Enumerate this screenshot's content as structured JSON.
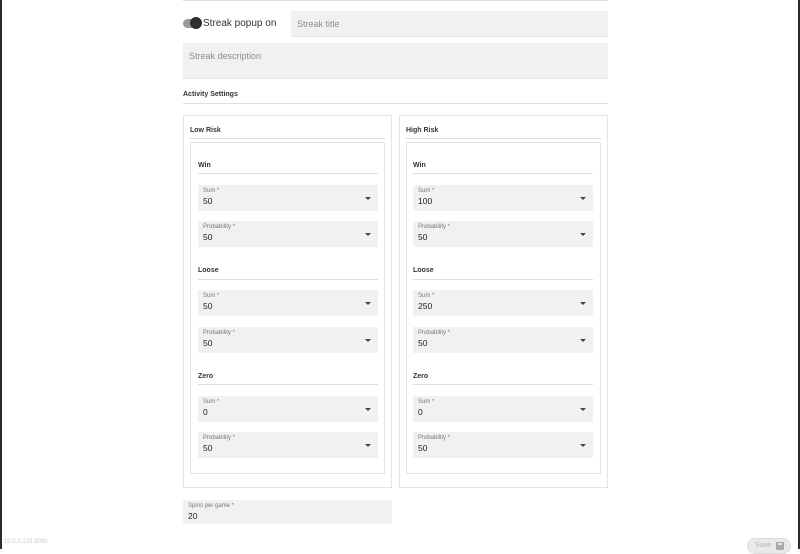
{
  "streak": {
    "toggle_label": "Streak popup on",
    "title_placeholder": "Streak title",
    "description_placeholder": "Streak description"
  },
  "activity_settings": {
    "title": "Activity Settings",
    "low_risk": {
      "title": "Low Risk",
      "win": {
        "title": "Win",
        "sum_label": "Sum *",
        "sum_value": "50",
        "prob_label": "Probability *",
        "prob_value": "50"
      },
      "loose": {
        "title": "Loose",
        "sum_label": "Sum *",
        "sum_value": "50",
        "prob_label": "Probability *",
        "prob_value": "50"
      },
      "zero": {
        "title": "Zero",
        "sum_label": "Sum *",
        "sum_value": "0",
        "prob_label": "Probability *",
        "prob_value": "50"
      }
    },
    "high_risk": {
      "title": "High Risk",
      "win": {
        "title": "Win",
        "sum_label": "Sum *",
        "sum_value": "100",
        "prob_label": "Probability *",
        "prob_value": "50"
      },
      "loose": {
        "title": "Loose",
        "sum_label": "Sum *",
        "sum_value": "250",
        "prob_label": "Probability *",
        "prob_value": "50"
      },
      "zero": {
        "title": "Zero",
        "sum_label": "Sum *",
        "sum_value": "0",
        "prob_label": "Probability *",
        "prob_value": "50"
      }
    }
  },
  "spins": {
    "label": "Spins per game *",
    "value": "20"
  },
  "footer": {
    "ip_text": "10.0.0.123:3000"
  },
  "save": {
    "label": "Save",
    "icon": "save-icon"
  }
}
